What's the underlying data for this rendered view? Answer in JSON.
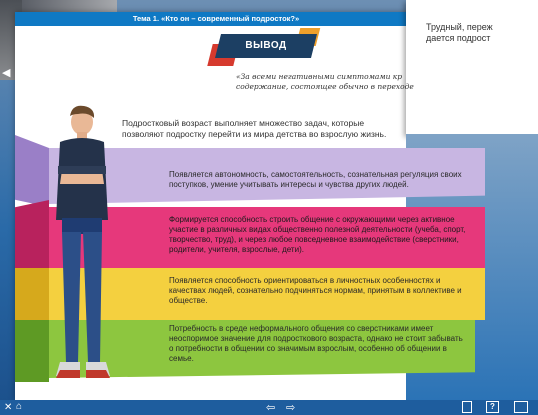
{
  "header": {
    "title": "Тема 1. «Кто он – современный подросток?»"
  },
  "banner": {
    "label": "ВЫВОД"
  },
  "quote": {
    "line1": "«За всеми негативными симптомами кр",
    "line2": "содержание, состоящее обычно в переходе"
  },
  "intro": "Подростковый возраст выполняет множество задач, которые позволяют подростку перейти из мира детства во взрослую жизнь.",
  "bands": [
    {
      "text": "Появляется автономность, самостоятельность, сознательная регуляция своих поступков, умение учитывать интересы и чувства других людей.",
      "color": "#c8b6e2"
    },
    {
      "text": "Формируется способность строить общение с окружающими через активное участие в различных видах общественно полезной деятельности (учеба, спорт, творчество, труд), и через любое повседневное взаимодействие (сверстники, родители, учителя, взрослые, дети).",
      "color": "#e6387b"
    },
    {
      "text": "Появляется способность ориентироваться в личностных особенностях и качествах людей, сознательно подчиняться нормам, принятым в коллективе и обществе.",
      "color": "#f4d03f"
    },
    {
      "text": "Потребность в среде неформального общения со сверстниками имеет неоспоримое значение для подросткового возраста, однако не стоит забывать о потребности в общении со значимым взрослым, особенно об общении в семье.",
      "color": "#8dc63f"
    }
  ],
  "right_panel": {
    "line1": "Трудный, переж",
    "line2": "дается подрост"
  },
  "controls": {
    "help_label": "?"
  }
}
